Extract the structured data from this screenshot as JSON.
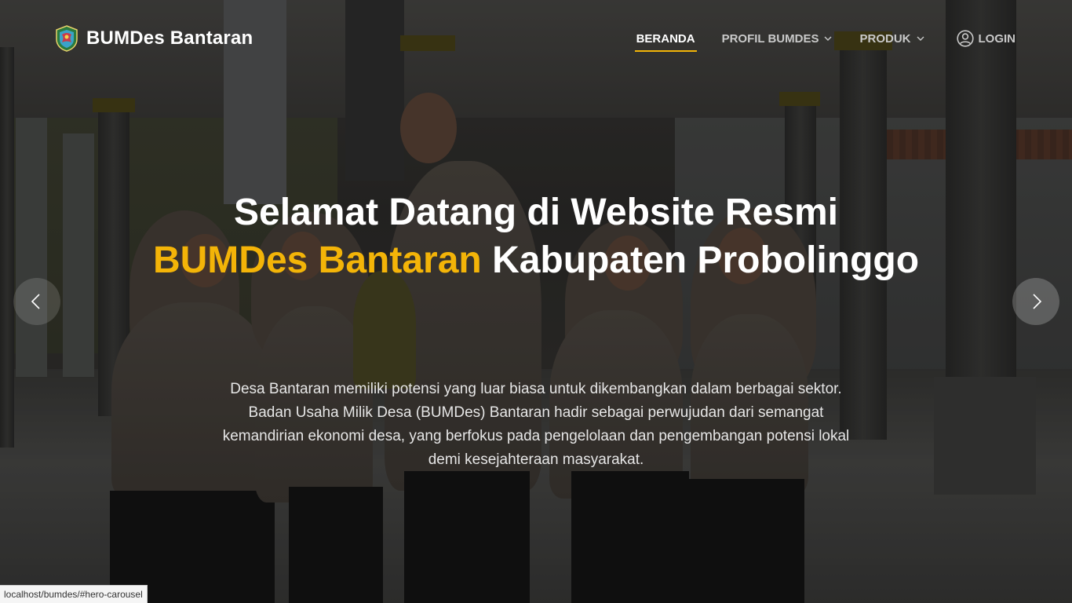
{
  "brand": {
    "name": "BUMDes Bantaran",
    "logo_icon": "village-emblem-icon"
  },
  "nav": {
    "items": [
      {
        "label": "BERANDA",
        "active": true,
        "has_dropdown": false
      },
      {
        "label": "PROFIL BUMDES",
        "active": false,
        "has_dropdown": true
      },
      {
        "label": "PRODUK",
        "active": false,
        "has_dropdown": true
      }
    ],
    "login_label": "LOGIN"
  },
  "hero": {
    "title_line1": "Selamat Datang di Website Resmi",
    "title_accent": "BUMDes Bantaran",
    "title_rest": " Kabupaten Probolinggo",
    "description": "Desa Bantaran memiliki potensi yang luar biasa untuk dikembangkan dalam berbagai sektor. Badan Usaha Milik Desa (BUMDes) Bantaran hadir sebagai perwujudan dari semangat kemandirian ekonomi desa, yang berfokus pada pengelolaan dan pengembangan potensi lokal demi kesejahteraan masyarakat."
  },
  "carousel": {
    "prev_icon": "chevron-left-icon",
    "next_icon": "chevron-right-icon"
  },
  "status_bar": {
    "url": "localhost/bumdes/#hero-carousel"
  },
  "colors": {
    "accent": "#f3b408",
    "text": "#ffffff"
  }
}
